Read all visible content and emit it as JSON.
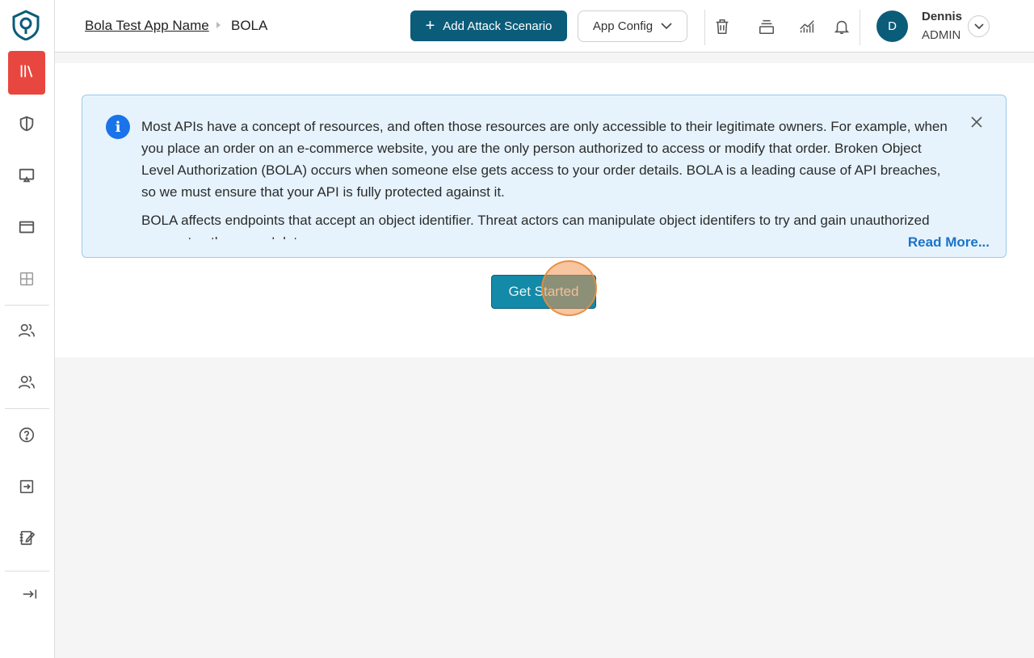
{
  "breadcrumb": {
    "app_name": "Bola Test App Name",
    "current": "BOLA"
  },
  "header": {
    "add_scenario_label": "Add Attack Scenario",
    "app_config_label": "App Config"
  },
  "user": {
    "initial": "D",
    "name": "Dennis",
    "role": "ADMIN"
  },
  "sidebar": {
    "items": [
      {
        "icon": "library-icon",
        "active": true
      },
      {
        "icon": "shield-icon",
        "active": false
      },
      {
        "icon": "monitor-icon",
        "active": false
      },
      {
        "icon": "browser-window-icon",
        "active": false
      },
      {
        "icon": "grid-icon",
        "active": false
      },
      {
        "icon": "users-icon",
        "active": false
      },
      {
        "icon": "team-icon",
        "active": false
      },
      {
        "icon": "help-icon",
        "active": false
      },
      {
        "icon": "import-icon",
        "active": false
      },
      {
        "icon": "notebook-edit-icon",
        "active": false
      },
      {
        "icon": "expand-sidebar-icon",
        "active": false
      }
    ]
  },
  "info": {
    "paragraph1": "Most APIs have a concept of resources, and often those resources are only accessible to their legitimate owners. For example, when you place an order on an e-commerce website, you are the only person authorized to access or modify that order. Broken Object Level Authorization (BOLA) occurs when someone else gets access to your order details. BOLA is a leading cause of API breaches, so we must ensure that your API is fully protected against it.",
    "paragraph2": "BOLA affects endpoints that accept an object identifier. Threat actors can manipulate object identifers to try and gain unauthorized access to other users' data.",
    "read_more": "Read More..."
  },
  "main": {
    "get_started_label": "Get Started"
  },
  "colors": {
    "primary": "#0b5c79",
    "accent_active": "#e8473f",
    "info_bg": "#e6f3fd",
    "link": "#1a73c8",
    "get_started": "#138aa7"
  }
}
